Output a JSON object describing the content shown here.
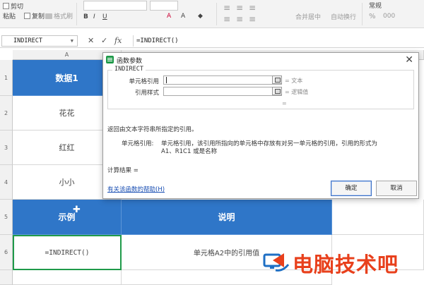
{
  "ribbon": {
    "cut": "剪切",
    "paste": "粘贴",
    "copy": "复制",
    "format_painter": "格式刷",
    "merge_center": "合并居中",
    "wrap_text": "自动换行",
    "number_format": "常规",
    "percent": "%",
    "thousands": "000"
  },
  "formula_bar": {
    "name_box": "INDIRECT",
    "cancel_icon": "close-icon",
    "confirm_icon": "check-icon",
    "fx": "fx",
    "formula": "=INDIRECT()"
  },
  "grid": {
    "col_a": "A",
    "rows": [
      "1",
      "2",
      "3",
      "4",
      "5",
      "6"
    ],
    "a1": "数据1",
    "a2": "花花",
    "a3": "红红",
    "a4": "小小",
    "a5": "示例",
    "b5": "说明",
    "a6": "=INDIRECT()",
    "b6": "单元格A2中的引用值",
    "header_color": "#2f76c8",
    "active_border_color": "#1f9a4a"
  },
  "dialog": {
    "title": "函数参数",
    "function_name": "INDIRECT",
    "arg1_label": "单元格引用",
    "arg1_result": "= 文本",
    "arg2_label": "引用样式",
    "arg2_result": "= 逻辑值",
    "equals": "=",
    "summary": "返回由文本字符串所指定的引用。",
    "arg_desc_label": "单元格引用:",
    "arg_desc_line1": "单元格引用，该引用所指向的单元格中存放有对另一单元格的引用，引用的形式为",
    "arg_desc_line2": "A1、R1C1 或是名称",
    "calc_result": "计算结果 =",
    "help_link": "有关该函数的帮助(H)",
    "ok": "确定",
    "cancel": "取消"
  },
  "watermark": {
    "text": "电脑技术吧",
    "color": "#e8401c"
  }
}
